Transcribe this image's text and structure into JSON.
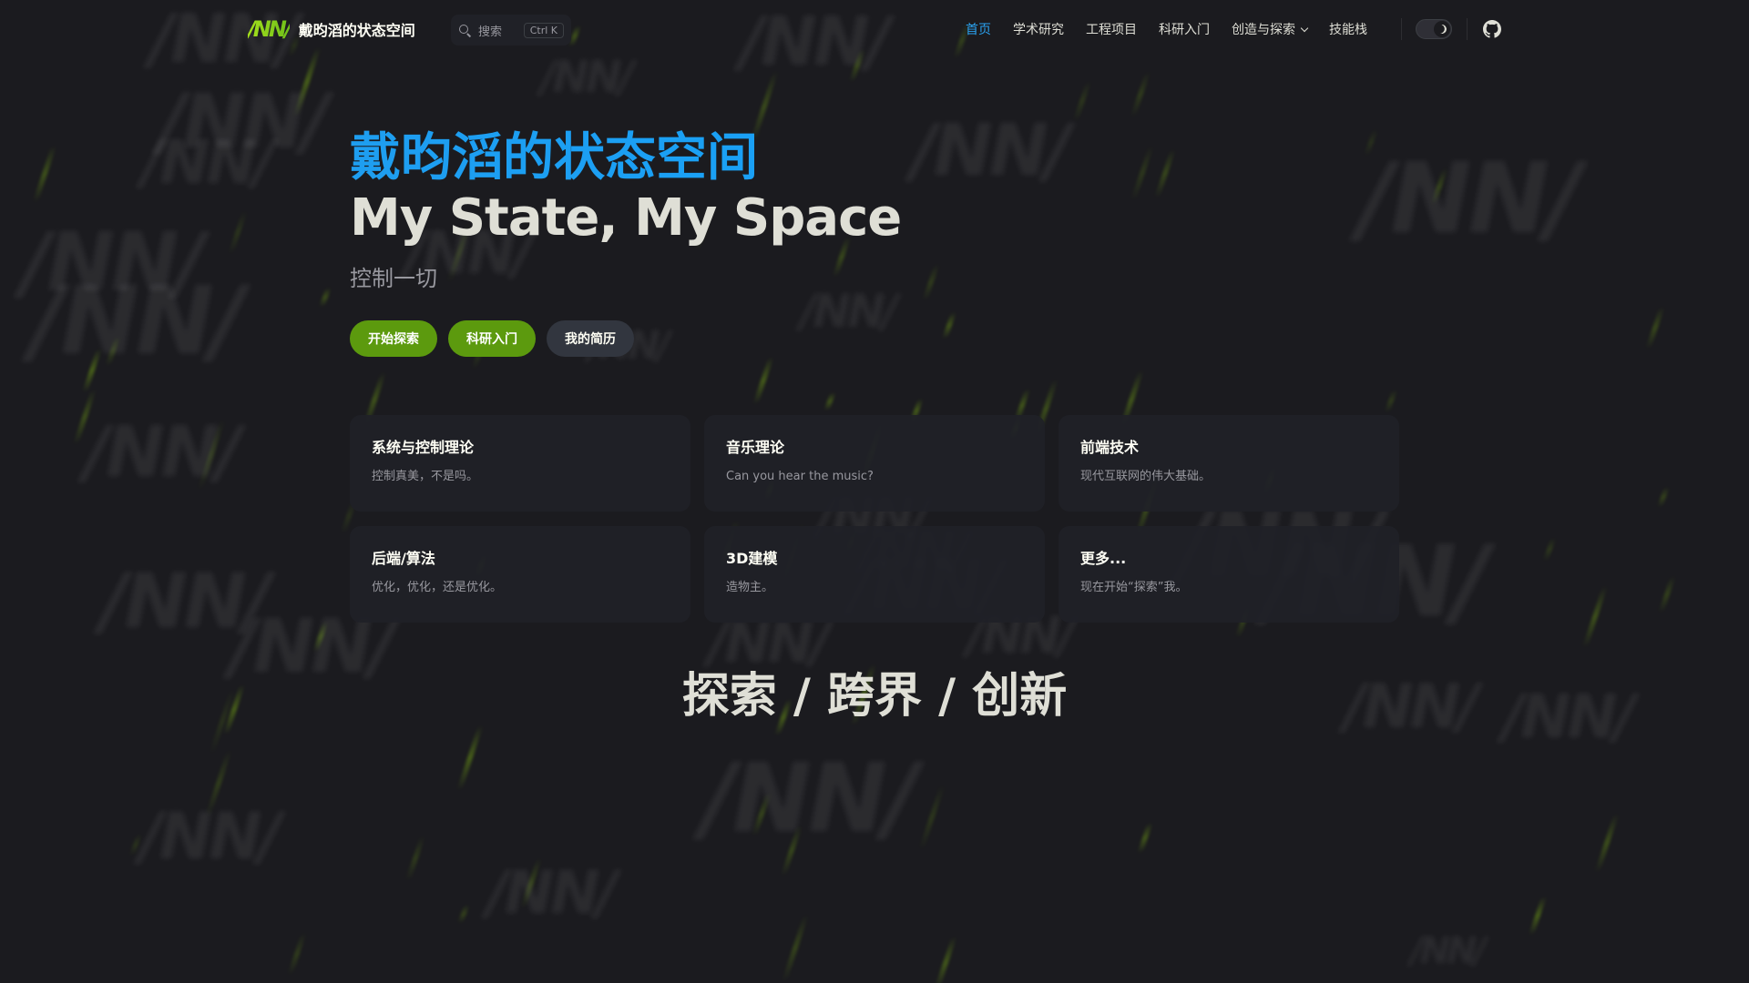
{
  "nav": {
    "brand_logo": "/NN/",
    "brand_name": "戴昀滔的状态空间",
    "search_placeholder": "搜索",
    "search_shortcut": "Ctrl K",
    "links": [
      {
        "label": "首页",
        "active": true
      },
      {
        "label": "学术研究"
      },
      {
        "label": "工程项目"
      },
      {
        "label": "科研入门"
      },
      {
        "label": "创造与探索",
        "dropdown": true
      },
      {
        "label": "技能栈"
      }
    ],
    "theme_icon": "moon-icon",
    "github_icon": "github-icon"
  },
  "hero": {
    "name": "戴昀滔的状态空间",
    "text": "My State, My Space",
    "tagline": "控制一切",
    "actions": [
      {
        "label": "开始探索",
        "theme": "brand"
      },
      {
        "label": "科研入门",
        "theme": "brand"
      },
      {
        "label": "我的简历",
        "theme": "alt"
      }
    ]
  },
  "features": [
    {
      "title": "系统与控制理论",
      "details": "控制真美，不是吗。"
    },
    {
      "title": "音乐理论",
      "details": "Can you hear the music?"
    },
    {
      "title": "前端技术",
      "details": "现代互联网的伟大基础。"
    },
    {
      "title": "后端/算法",
      "details": "优化，优化，还是优化。"
    },
    {
      "title": "3D建模",
      "details": "造物主。"
    },
    {
      "title": "更多...",
      "details": "现在开始“探索”我。"
    }
  ],
  "slogan": "探索 / 跨界 / 创新",
  "colors": {
    "brand_blue": "#1e9ef0",
    "brand_green": "#5c9a0e",
    "background": "#1b1b1f"
  }
}
